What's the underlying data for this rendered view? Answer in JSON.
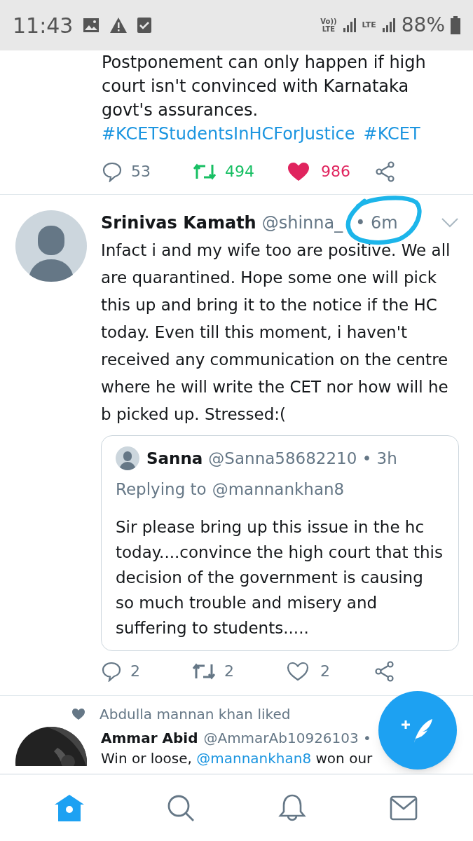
{
  "status_bar": {
    "time": "11:43",
    "network_1": "Vo))\nLTE",
    "network_2": "LTE",
    "battery": "88%"
  },
  "tweets": [
    {
      "kind": "partial",
      "text": "Postponement can only happen if high court isn't convinced with Karnataka govt's assurances.",
      "hashtags": [
        "#KCETStudentsInHCForJustice",
        "#KCET"
      ],
      "replies": "53",
      "retweets": "494",
      "likes": "986",
      "retweeted": true,
      "liked": true
    },
    {
      "kind": "full",
      "name": "Srinivas Kamath",
      "handle": "@shinna_",
      "time": "• 6m",
      "annotated": true,
      "text": "Infact i and my wife too are positive. We all are quarantined. Hope some one will pick this up and bring it to the notice if the HC today. Even till this moment, i haven't received any communication on the centre where he will write the CET nor how will he b picked up. Stressed:(",
      "quote": {
        "name": "Sanna",
        "handle": "@Sanna58682210 • 3h",
        "replying_label": "Replying to",
        "replying_to": "@mannankhan8",
        "text": "Sir please bring up this issue in the hc today....convince the high court that this decision of the government is causing so much trouble and misery and suffering to students....."
      },
      "replies": "2",
      "retweets": "2",
      "likes": "2",
      "retweeted": false,
      "liked": false
    },
    {
      "kind": "cut",
      "social_context": "Abdulla mannan khan liked",
      "name": "Ammar Abid",
      "handle": "@AmmarAb10926103 •",
      "text_before": "Win or loose,",
      "mention": "@mannankhan8",
      "text_after": "won our"
    }
  ],
  "nav": [
    {
      "selected": true
    },
    {
      "selected": false
    },
    {
      "selected": false
    },
    {
      "selected": false
    }
  ]
}
